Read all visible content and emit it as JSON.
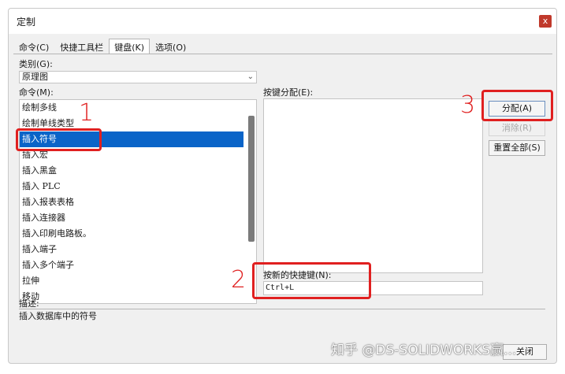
{
  "window": {
    "title": "定制",
    "close_glyph": "x"
  },
  "tabs": [
    {
      "label": "命令(C)"
    },
    {
      "label": "快捷工具栏"
    },
    {
      "label": "键盘(K)",
      "active": true
    },
    {
      "label": "选项(O)"
    }
  ],
  "category": {
    "label": "类别(G):",
    "value": "原理图"
  },
  "commands": {
    "label": "命令(M):",
    "items": [
      "绘制多线",
      "绘制单线类型",
      "插入符号",
      "插入宏",
      "插入黑盒",
      "插入 PLC",
      "插入报表表格",
      "插入连接器",
      "插入印刷电路板。",
      "插入端子",
      "插入多个端子",
      "拉伸",
      "移动"
    ],
    "selected": "插入符号"
  },
  "key_assign": {
    "label": "按键分配(E):"
  },
  "new_shortcut": {
    "label": "按新的快捷键(N):",
    "value": "Ctrl+L"
  },
  "buttons": {
    "assign": "分配(A)",
    "remove": "消除(R)",
    "reset_all": "重置全部(S)",
    "bottom": "关闭"
  },
  "description": {
    "label": "描述:",
    "text": "插入数据库中的符号"
  },
  "annotations": {
    "marker1": "1",
    "marker2": "2",
    "marker3": "3"
  },
  "watermark": "知乎 @DS-SOLIDWORKS赢...",
  "colors": {
    "accent_red": "#e02020",
    "selection_blue": "#0a64c8"
  }
}
